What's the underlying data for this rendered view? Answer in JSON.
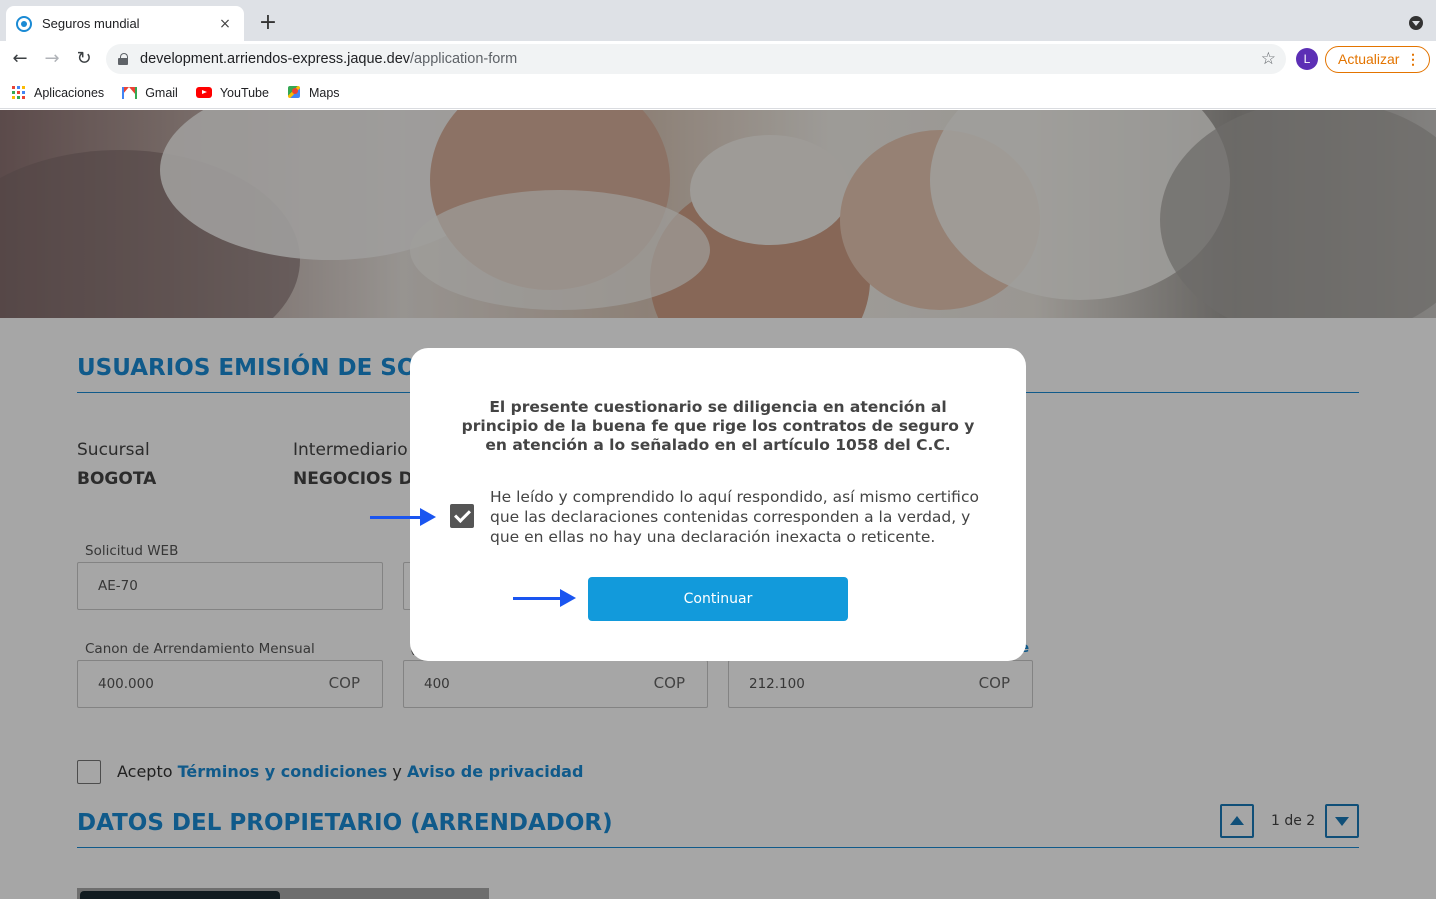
{
  "browser": {
    "tab_title": "Seguros mundial",
    "tab_close": "×",
    "new_tab": "+",
    "url_host": "development.arriendos-express.jaque.dev",
    "url_path": "/application-form",
    "profile_initial": "L",
    "update_label": "Actualizar",
    "update_menu": "⋮",
    "bookmarks": [
      {
        "label": "Aplicaciones",
        "icon": "apps-icon"
      },
      {
        "label": "Gmail",
        "icon": "gmail-icon"
      },
      {
        "label": "YouTube",
        "icon": "youtube-icon"
      },
      {
        "label": "Maps",
        "icon": "maps-icon"
      }
    ]
  },
  "page": {
    "section1_title": "USUARIOS EMISIÓN DE SOLIC",
    "sucursal_label": "Sucursal",
    "sucursal_value": "BOGOTA",
    "intermediario_label": "Intermediario",
    "intermediario_value": "NEGOCIOS DI",
    "solicitud_label": "Solicitud WEB",
    "solicitud_value": "AE-70",
    "canon_label": "Canon de Arrendamiento Mensual",
    "canon_value": "400.000",
    "canon_suffix": "COP",
    "field2_label_fragment": "(",
    "field2_value": "400",
    "field2_suffix": "COP",
    "field3_label_fragment": "e",
    "field3_value": "212.100",
    "field3_suffix": "COP",
    "accept_prefix": "Acepto",
    "terms_link": "Términos y condiciones",
    "accept_and": "y",
    "privacy_link": "Aviso de privacidad",
    "section2_title": "DATOS DEL PROPIETARIO (ARRENDADOR)",
    "pager_text": "1 de 2"
  },
  "modal": {
    "heading": "El presente cuestionario se diligencia en atención al principio de la buena fe que rige los contratos de seguro y en atención a lo señalado en el artículo 1058 del C.C.",
    "statement": "He leído y comprendido lo aquí respondido, así mismo certifico que las declaraciones contenidas corresponden a la verdad, y que en ellas no hay una declaración inexacta o reticente.",
    "checkbox_checked": true,
    "continue_label": "Continuar"
  },
  "colors": {
    "accent": "#1a8ad4",
    "button": "#129adb",
    "annotation_arrow": "#1a55f0",
    "update_orange": "#e37400"
  }
}
